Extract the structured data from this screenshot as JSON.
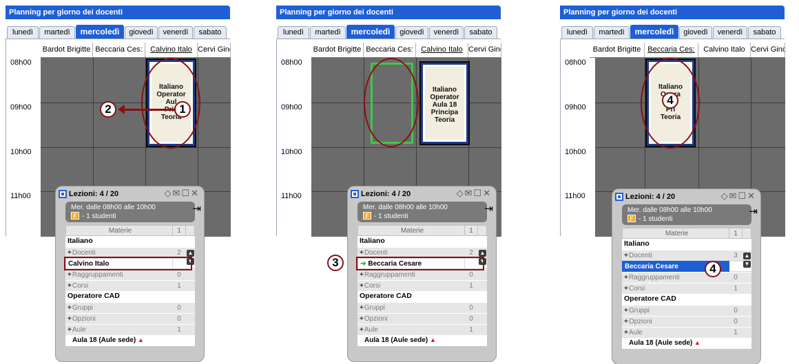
{
  "window_title": "Planning per giorno dei docenti",
  "tabs": [
    "lunedì",
    "martedì",
    "mercoledì",
    "giovedì",
    "venerdì",
    "sabato"
  ],
  "active_tab": "mercoledì",
  "teachers": [
    "Bardot Brigitte",
    "Beccaria Cesare",
    "Calvino Italo",
    "Cervi Gino"
  ],
  "teacher_headers_cut": [
    "Bardot Brigitte",
    "Beccaria Ces:",
    "Calvino Italo",
    "Cervi Gino"
  ],
  "hours": [
    "08h00",
    "09h00",
    "10h00",
    "11h00"
  ],
  "lesson_lines": [
    "Italiano",
    "Operator",
    "Aula 18",
    "Principa",
    "Teoria"
  ],
  "lesson_lines_p1": [
    "Italiano",
    "Operator",
    "Aul",
    "Prin",
    "Teoria"
  ],
  "lesson_lines_p3": [
    "Italiano",
    "Opera",
    "A",
    "Pri",
    "Teoria"
  ],
  "popup": {
    "title": "Lezioni: 4 / 20",
    "schedule": "Mer. dalle 08h00 alle 10h00",
    "badge": "F",
    "students": "- 1 studenti",
    "header_label": "Materie",
    "header_count": "1",
    "subject": "Italiano",
    "docenti_label": "Docenti",
    "docenti_count_cut": "2",
    "docenti_count": "3",
    "teacher_p1": "Calvino Italo",
    "teacher_p2": "Beccaria Cesare",
    "teacher_p3": "Beccaria Cesare",
    "raggruppamenti_label": "Raggruppamenti",
    "raggruppamenti_count": "0",
    "corsi_label": "Corsi",
    "corsi_count": "1",
    "course": "Operatore CAD",
    "gruppi_label": "Gruppi",
    "gruppi_count": "0",
    "opzioni_label": "Opzioni",
    "opzioni_count": "0",
    "aule_label": "Aule",
    "aule_count": "1",
    "room": "Aula 18 (Aule sede)"
  },
  "annotations": {
    "step1": "1",
    "step2": "2",
    "step3": "3",
    "step4": "4"
  },
  "colors": {
    "title_bar": "#1f5fd6",
    "grid": "#6b6b6b",
    "annotation": "#8a1010",
    "drop_target": "#3ec84a",
    "selection": "#1f5fd6"
  }
}
